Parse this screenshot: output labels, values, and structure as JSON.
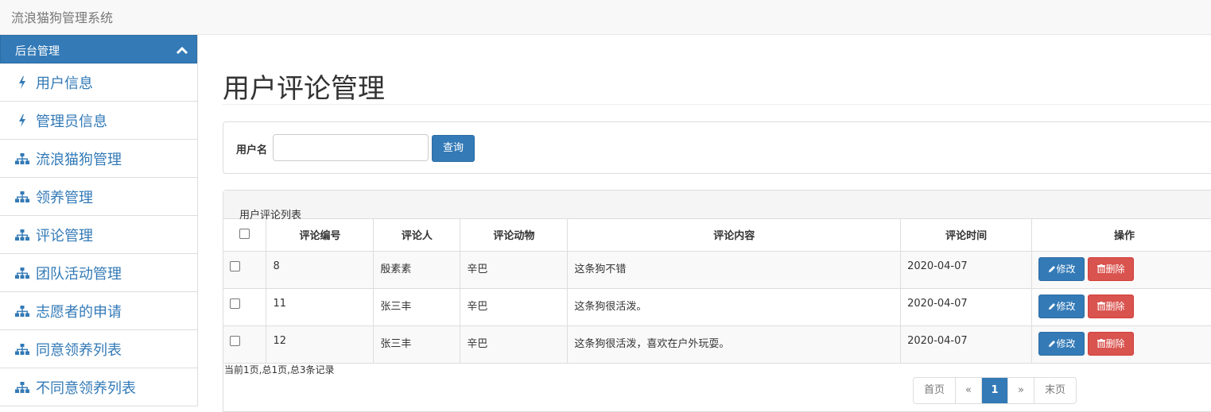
{
  "app": {
    "title": "流浪猫狗管理系统"
  },
  "sidebar": {
    "header": "后台管理",
    "items": [
      {
        "label": "用户信息",
        "icon": "bolt-icon"
      },
      {
        "label": "管理员信息",
        "icon": "bolt-icon"
      },
      {
        "label": "流浪猫狗管理",
        "icon": "sitemap-icon"
      },
      {
        "label": "领养管理",
        "icon": "sitemap-icon"
      },
      {
        "label": "评论管理",
        "icon": "sitemap-icon"
      },
      {
        "label": "团队活动管理",
        "icon": "sitemap-icon"
      },
      {
        "label": "志愿者的申请",
        "icon": "sitemap-icon"
      },
      {
        "label": "同意领养列表",
        "icon": "sitemap-icon"
      },
      {
        "label": "不同意领养列表",
        "icon": "sitemap-icon"
      }
    ]
  },
  "main": {
    "title": "用户评论管理",
    "search": {
      "label": "用户名",
      "value": "",
      "button": "查询"
    },
    "list": {
      "title": "用户评论列表",
      "columns": [
        "评论编号",
        "评论人",
        "评论动物",
        "评论内容",
        "评论时间",
        "操作"
      ],
      "rows": [
        {
          "id": "8",
          "user": "殷素素",
          "animal": "辛巴",
          "content": "这条狗不错",
          "time": "2020-04-07"
        },
        {
          "id": "11",
          "user": "张三丰",
          "animal": "辛巴",
          "content": "这条狗很活泼。",
          "time": "2020-04-07"
        },
        {
          "id": "12",
          "user": "张三丰",
          "animal": "辛巴",
          "content": "这条狗很活泼，喜欢在户外玩耍。",
          "time": "2020-04-07"
        }
      ],
      "edit_label": "修改",
      "delete_label": "删除"
    },
    "pagination": {
      "info": "当前1页,总1页,总3条记录",
      "first": "首页",
      "prev": "«",
      "current": "1",
      "next": "»",
      "last": "末页"
    }
  },
  "colors": {
    "primary": "#337ab7",
    "danger": "#d9534f"
  }
}
